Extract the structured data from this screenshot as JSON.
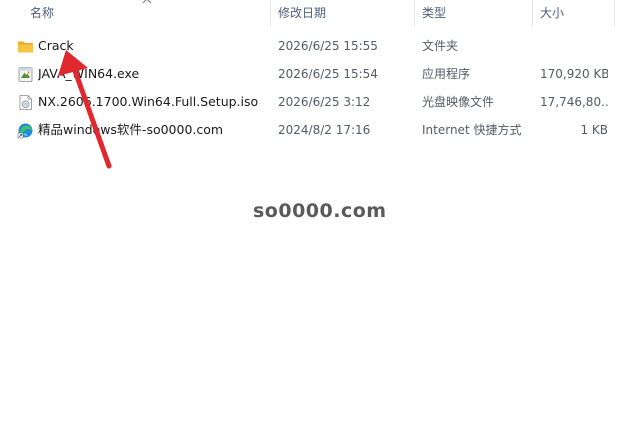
{
  "columns": {
    "name": "名称",
    "modified": "修改日期",
    "type": "类型",
    "size": "大小"
  },
  "files": [
    {
      "name": "Crack",
      "modified": "2026/6/25 15:55",
      "type": "文件夹",
      "size": "",
      "icon": "folder-icon"
    },
    {
      "name": "JAVA_WIN64.exe",
      "modified": "2026/6/25 15:54",
      "type": "应用程序",
      "size": "170,920 KB",
      "icon": "exe-installer-icon"
    },
    {
      "name": "NX.2606.1700.Win64.Full.Setup.iso",
      "modified": "2026/6/25 3:12",
      "type": "光盘映像文件",
      "size": "17,746,80...",
      "icon": "disc-image-icon"
    },
    {
      "name": "精品windows软件-so0000.com",
      "modified": "2024/8/2 17:16",
      "type": "Internet 快捷方式",
      "size": "1 KB",
      "icon": "edge-shortcut-icon"
    }
  ],
  "watermark": "so0000.com",
  "colors": {
    "header_text": "#4c607a",
    "arrow": "#e0282e",
    "folder": "#f6c443"
  }
}
